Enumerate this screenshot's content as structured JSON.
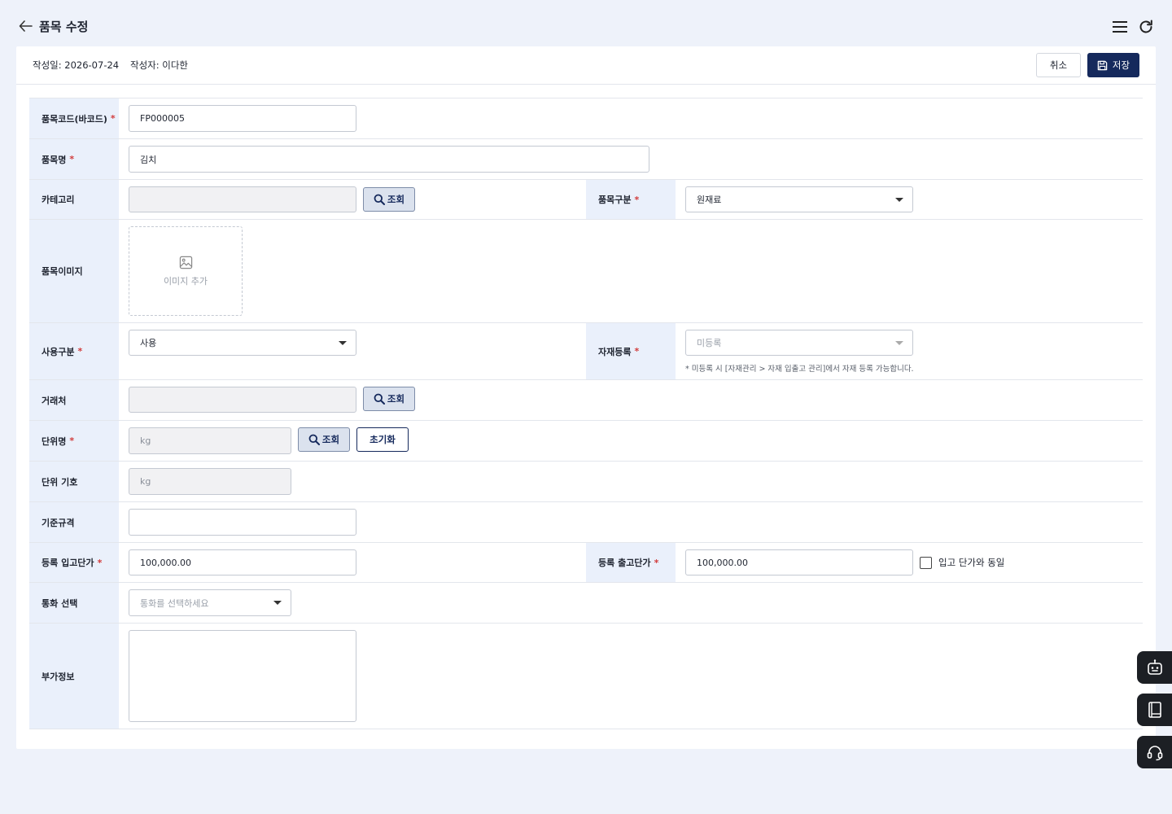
{
  "header": {
    "title": "품목 수정"
  },
  "meta": {
    "created": "작성일: 2026-07-24",
    "author": "작성자: 이다한"
  },
  "actions": {
    "cancel": "취소",
    "save": "저장"
  },
  "form": {
    "item_code": {
      "label": "품목코드(바코드)",
      "value": "FP000005"
    },
    "item_name": {
      "label": "품목명",
      "value": "김치"
    },
    "category": {
      "label": "카테고리",
      "value": "",
      "lookup": "조회"
    },
    "item_type": {
      "label": "품목구분",
      "value": "원재료"
    },
    "item_image": {
      "label": "품목이미지",
      "add_text": "이미지 추가"
    },
    "usage": {
      "label": "사용구분",
      "value": "사용"
    },
    "material_reg": {
      "label": "자재등록",
      "value": "미등록",
      "hint": "* 미등록 시 [자재관리 > 자재 입출고 관리]에서 자재 등록 가능합니다."
    },
    "vendor": {
      "label": "거래처",
      "value": "",
      "lookup": "조회"
    },
    "unit_name": {
      "label": "단위명",
      "value": "kg",
      "lookup": "조회",
      "reset": "초기화"
    },
    "unit_symbol": {
      "label": "단위 기호",
      "value": "kg"
    },
    "standard_spec": {
      "label": "기준규격",
      "value": ""
    },
    "in_price": {
      "label": "등록 입고단가",
      "value": "100,000.00"
    },
    "out_price": {
      "label": "등록 출고단가",
      "value": "100,000.00",
      "same_as_in": "입고 단가와 동일",
      "same_checked": false
    },
    "currency": {
      "label": "통화 선택",
      "placeholder": "통화를 선택하세요"
    },
    "extra_info": {
      "label": "부가정보",
      "value": ""
    }
  },
  "colors": {
    "primary": "#15295c",
    "label_bg": "#eaf0fb",
    "page_bg": "#eef2fa",
    "required": "#d23b3b"
  }
}
